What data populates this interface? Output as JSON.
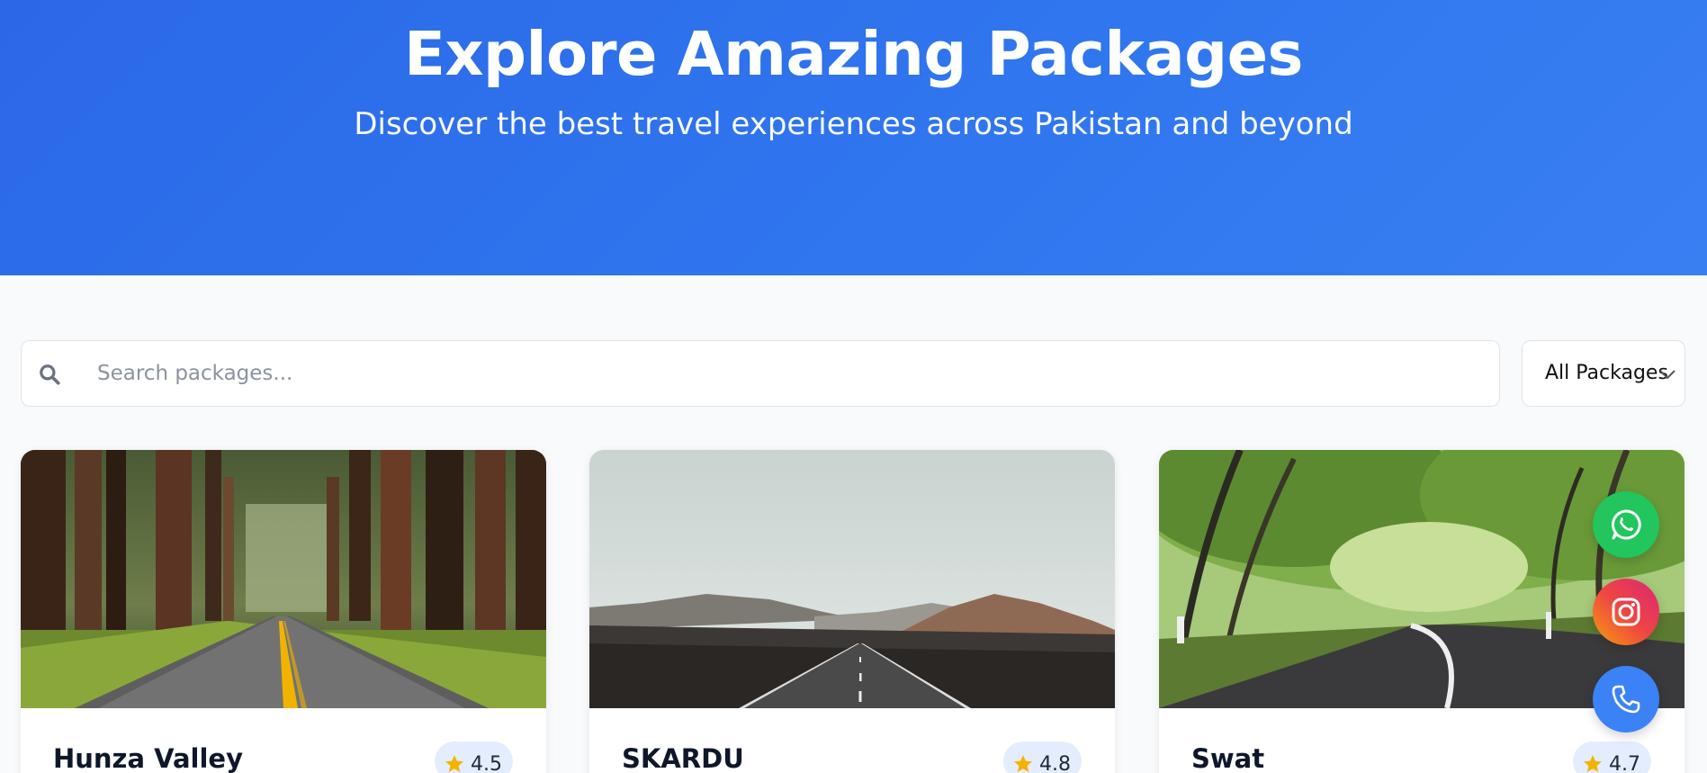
{
  "hero": {
    "title": "Explore Amazing Packages",
    "subtitle": "Discover the best travel experiences across Pakistan and beyond",
    "background_color": "#2b68e8"
  },
  "search": {
    "placeholder": "Search packages...",
    "value": "",
    "icon": "search-icon"
  },
  "filter": {
    "selected": "All Packages",
    "icon": "chevron-down-icon"
  },
  "packages": [
    {
      "title": "Hunza Valley",
      "rating": "4.5",
      "image": "forest road"
    },
    {
      "title": "SKARDU",
      "rating": "4.8",
      "image": "mountain desert road"
    },
    {
      "title": "Swat",
      "rating": "4.7",
      "image": "green tree tunnel road"
    }
  ],
  "floating_actions": [
    {
      "name": "whatsapp",
      "icon": "whatsapp-icon",
      "color": "#22c55e"
    },
    {
      "name": "instagram",
      "icon": "instagram-icon",
      "color": "#e1306c"
    },
    {
      "name": "phone",
      "icon": "phone-icon",
      "color": "#3b82f6"
    }
  ],
  "colors": {
    "accent": "#3b82f6",
    "star": "#f5b301",
    "rating_badge_bg": "#e4edfd"
  }
}
